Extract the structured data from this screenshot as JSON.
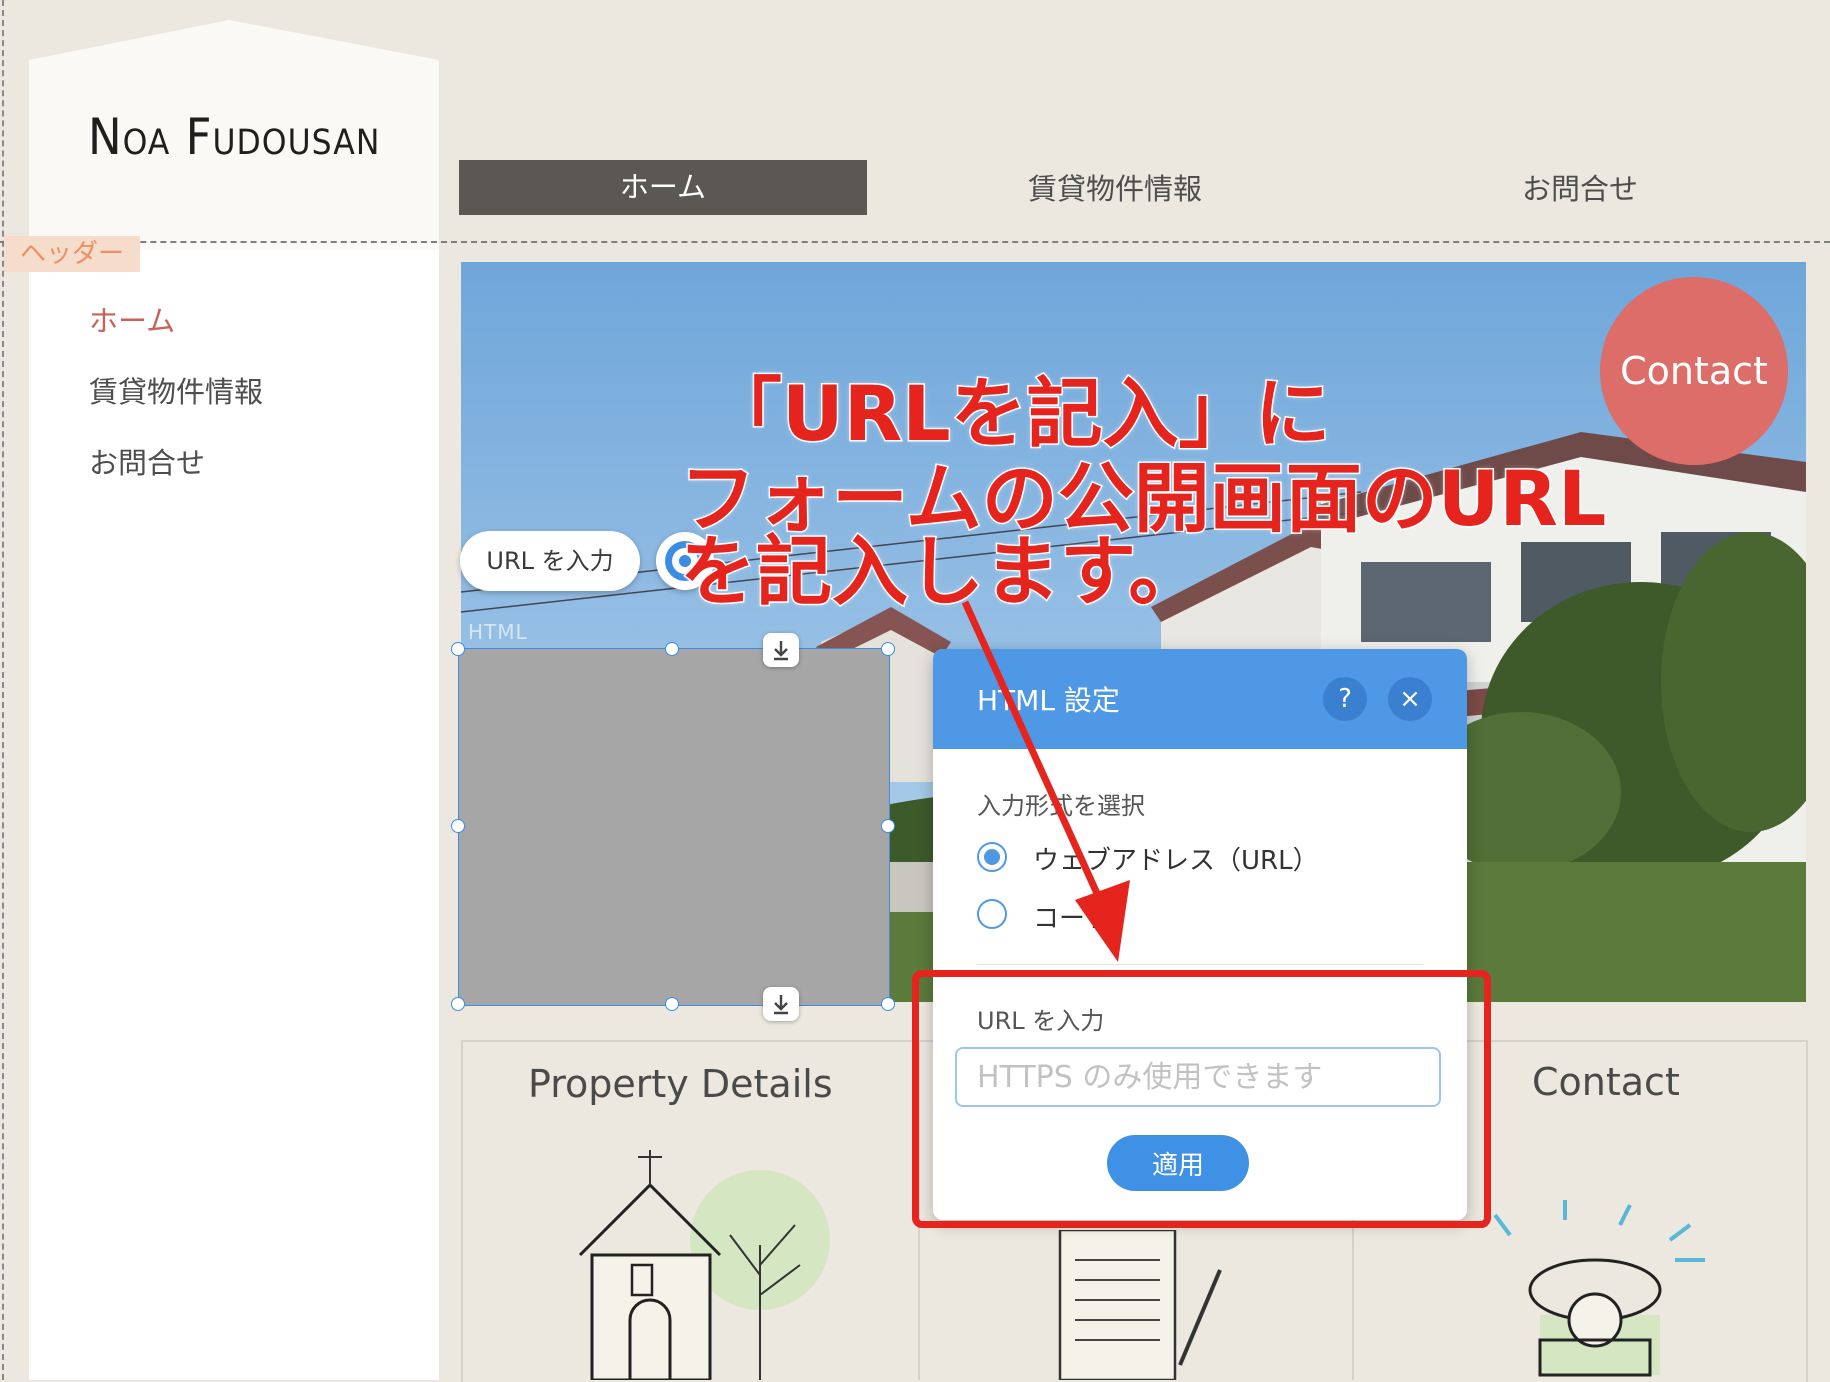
{
  "site": {
    "logo": "Noa Fudousan",
    "header_tag": "ヘッダー"
  },
  "top_nav": [
    {
      "label": "ホーム",
      "active": true
    },
    {
      "label": "賃貸物件情報",
      "active": false
    },
    {
      "label": "お問合せ",
      "active": false
    }
  ],
  "side_nav": [
    {
      "label": "ホーム",
      "active": true
    },
    {
      "label": "賃貸物件情報",
      "active": false
    },
    {
      "label": "お問合せ",
      "active": false
    }
  ],
  "hero": {
    "contact_circle": "Contact"
  },
  "editor": {
    "url_chip": "URL を入力",
    "element_tag": "HTML"
  },
  "annotation": {
    "line1": "「URLを記入」に",
    "line2": "フォームの公開画面のURL",
    "line3": "を記入します。",
    "color": "#e5241e"
  },
  "cards": {
    "col1_title": "Property Details",
    "col3_title": "Contact"
  },
  "dialog": {
    "title": "HTML 設定",
    "help_icon": "?",
    "close_icon": "×",
    "select_label": "入力形式を選択",
    "option_url": "ウェブアドレス（URL）",
    "option_code": "コード",
    "url_label": "URL を入力",
    "url_placeholder": "HTTPS のみ使用できます",
    "url_value": "",
    "apply_label": "適用",
    "accent": "#4f98e6"
  }
}
